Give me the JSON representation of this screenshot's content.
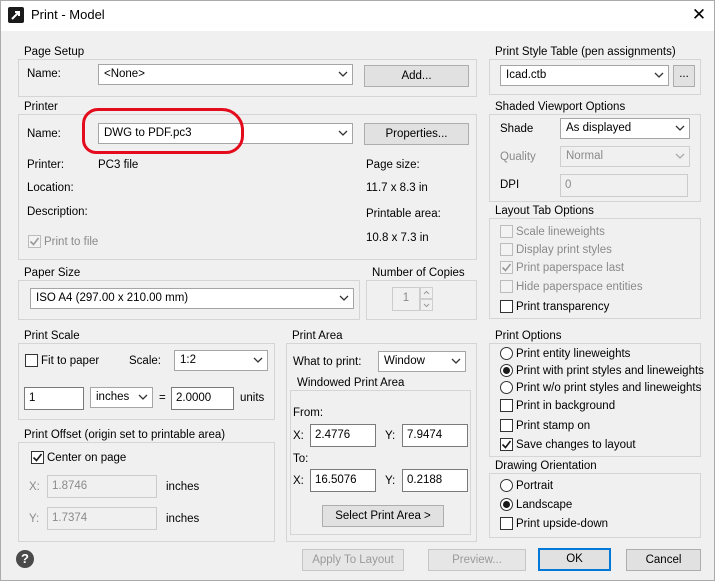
{
  "window": {
    "title": "Print - Model",
    "close_symbol": "✕"
  },
  "page_setup": {
    "legend": "Page Setup",
    "name_label": "Name:",
    "name_value": "<None>",
    "add_button": "Add..."
  },
  "printer": {
    "legend": "Printer",
    "name_label": "Name:",
    "name_value": "DWG to PDF.pc3",
    "properties_button": "Properties...",
    "printer_label": "Printer:",
    "printer_value": "PC3 file",
    "location_label": "Location:",
    "description_label": "Description:",
    "page_size_label": "Page size:",
    "page_size_value": "11.7 x 8.3 in",
    "printable_area_label": "Printable area:",
    "printable_area_value": "10.8 x 7.3 in",
    "print_to_file_label": "Print to file",
    "print_to_file_checked": true
  },
  "paper_size": {
    "legend": "Paper Size",
    "value": "ISO A4 (297.00 x 210.00 mm)"
  },
  "copies": {
    "legend": "Number of Copies",
    "value": "1"
  },
  "print_scale": {
    "legend": "Print Scale",
    "fit_label": "Fit to paper",
    "fit_checked": false,
    "scale_label": "Scale:",
    "scale_value": "1:2",
    "amount": "1",
    "unit": "inches",
    "equals": "=",
    "units_value": "2.0000",
    "units_label": "units"
  },
  "print_offset": {
    "legend": "Print Offset (origin set to printable area)",
    "center_label": "Center on page",
    "center_checked": true,
    "x_label": "X:",
    "x_value": "1.8746",
    "x_unit": "inches",
    "y_label": "Y:",
    "y_value": "1.7374",
    "y_unit": "inches"
  },
  "print_area": {
    "legend": "Print Area",
    "what_label": "What to print:",
    "what_value": "Window",
    "windowed_legend": "Windowed Print Area",
    "from_label": "From:",
    "to_label": "To:",
    "from_x_label": "X:",
    "from_x": "2.4776",
    "from_y_label": "Y:",
    "from_y": "7.9474",
    "to_x_label": "X:",
    "to_x": "16.5076",
    "to_y_label": "Y:",
    "to_y": "0.2188",
    "select_button": "Select Print Area >"
  },
  "print_style": {
    "legend": "Print Style Table (pen assignments)",
    "value": "Icad.ctb",
    "browse_button": "..."
  },
  "shaded": {
    "legend": "Shaded Viewport Options",
    "shade_label": "Shade",
    "shade_value": "As displayed",
    "quality_label": "Quality",
    "quality_value": "Normal",
    "dpi_label": "DPI",
    "dpi_value": "0"
  },
  "layout_tab": {
    "legend": "Layout Tab Options",
    "items": [
      {
        "label": "Scale lineweights",
        "checked": false,
        "enabled": false
      },
      {
        "label": "Display print styles",
        "checked": false,
        "enabled": false
      },
      {
        "label": "Print paperspace last",
        "checked": true,
        "enabled": false
      },
      {
        "label": "Hide paperspace entities",
        "checked": false,
        "enabled": false
      },
      {
        "label": "Print transparency",
        "checked": false,
        "enabled": true
      }
    ]
  },
  "print_options": {
    "legend": "Print Options",
    "radios": [
      {
        "label": "Print entity lineweights",
        "selected": false
      },
      {
        "label": "Print with print styles and lineweights",
        "selected": true
      },
      {
        "label": "Print w/o print styles and lineweights",
        "selected": false
      }
    ],
    "checks": [
      {
        "label": "Print in background",
        "checked": false
      },
      {
        "label": "Print stamp on",
        "checked": false
      },
      {
        "label": "Save changes to layout",
        "checked": true
      }
    ]
  },
  "orientation": {
    "legend": "Drawing Orientation",
    "portrait_label": "Portrait",
    "landscape_label": "Landscape",
    "selected": "Landscape",
    "upside_down_label": "Print upside-down",
    "upside_down_checked": false
  },
  "footer": {
    "help_symbol": "?",
    "apply_button": "Apply To Layout",
    "preview_button": "Preview...",
    "ok_button": "OK",
    "cancel_button": "Cancel"
  },
  "colors": {
    "annotation": "#e30b1c",
    "focus": "#0078d7"
  },
  "icons": [
    "app-icon",
    "close-icon",
    "chevron-down-icon",
    "checkmark-icon",
    "help-icon",
    "spin-up-icon",
    "spin-down-icon"
  ]
}
